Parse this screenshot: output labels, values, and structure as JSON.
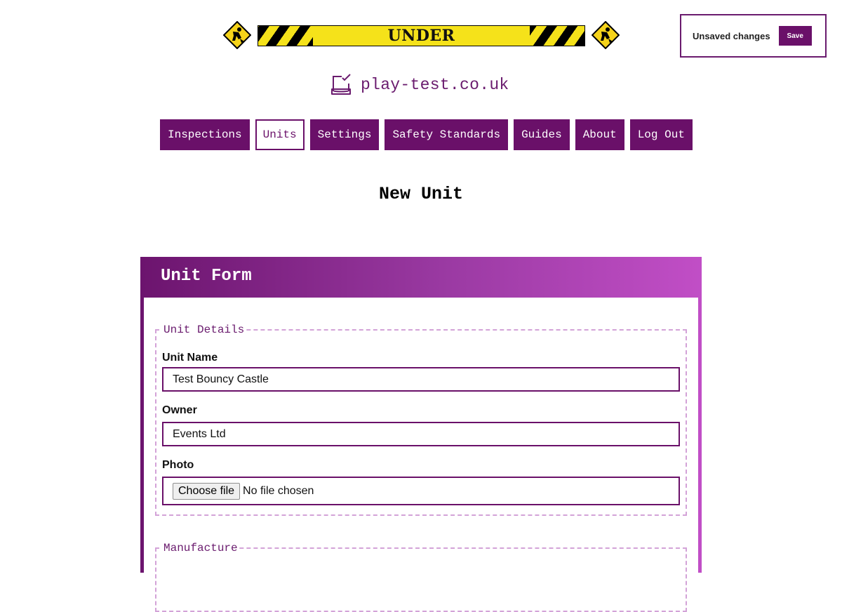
{
  "banner": {
    "text": "UNDER CONSTRUCTION",
    "colors": {
      "stripe_dark": "#000000",
      "stripe_light": "#f5e21a"
    },
    "icons": [
      "construction-worker-sign-icon",
      "construction-worker-sign-icon"
    ]
  },
  "unsaved": {
    "message": "Unsaved changes",
    "save_label": "Save"
  },
  "logo": {
    "icon": "checkbox-tray-icon",
    "text": "play-test.co.uk"
  },
  "nav": {
    "items": [
      {
        "label": "Inspections",
        "active": false
      },
      {
        "label": "Units",
        "active": true
      },
      {
        "label": "Settings",
        "active": false
      },
      {
        "label": "Safety Standards",
        "active": false
      },
      {
        "label": "Guides",
        "active": false
      },
      {
        "label": "About",
        "active": false
      },
      {
        "label": "Log Out",
        "active": false
      }
    ]
  },
  "page": {
    "title": "New Unit"
  },
  "form": {
    "title": "Unit Form",
    "unit_details": {
      "legend": "Unit Details",
      "unit_name": {
        "label": "Unit Name",
        "value": "Test Bouncy Castle"
      },
      "owner": {
        "label": "Owner",
        "value": "Events Ltd"
      },
      "photo": {
        "label": "Photo",
        "button_label": "Choose file",
        "status": "No file chosen"
      }
    },
    "manufacture": {
      "legend": "Manufacture"
    }
  },
  "colors": {
    "brand_purple": "#6a1069",
    "gradient_end": "#c14ec6",
    "fieldset_border": "#d3a3d8"
  }
}
